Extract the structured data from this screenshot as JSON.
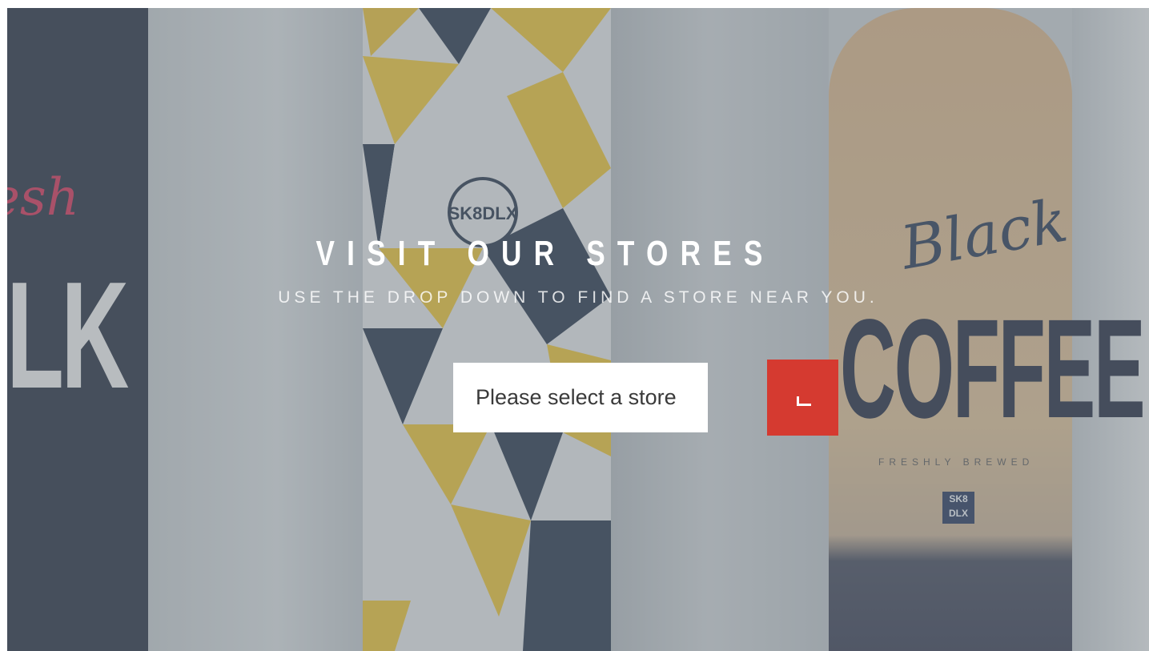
{
  "hero": {
    "title": "VISIT OUR STORES",
    "subtitle": "USE THE DROP DOWN TO FIND A STORE NEAR YOU.",
    "background_text": {
      "fresh": "esh",
      "milk": "ILK",
      "deck_logo": "SK8DLX",
      "black": "Black",
      "coffee": "COFFEE",
      "brewed": "FRESHLY BREWED",
      "badge": "SK8 DLX"
    }
  },
  "store_select": {
    "placeholder": "Please select a store",
    "selected": "Please select a store"
  },
  "go_button": {
    "icon": "chevron-down-icon",
    "color": "#d53a30"
  },
  "colors": {
    "accent": "#d53a30",
    "title": "#ffffff"
  }
}
